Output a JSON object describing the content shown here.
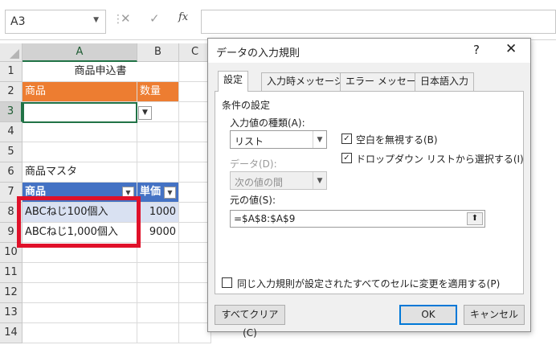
{
  "formula_bar": {
    "name_box": "A3",
    "name_dropdown_icon": "chevron-down-icon",
    "cancel_icon": "✕",
    "enter_icon": "✓",
    "fx_label": "fx",
    "formula_value": ""
  },
  "grid": {
    "columns": [
      "A",
      "B",
      "C"
    ],
    "rows": [
      "1",
      "2",
      "3",
      "4",
      "5",
      "6",
      "7",
      "8",
      "9",
      "10",
      "11",
      "12",
      "13",
      "14"
    ],
    "cells": {
      "a1": "商品申込書",
      "a2": "商品",
      "b2": "数量",
      "a3": "",
      "a6": "商品マスタ",
      "a7": "商品",
      "b7": "単価",
      "a8": "ABCねじ100個入",
      "b8": "1000",
      "a9": "ABCねじ1,000個入",
      "b9": "9000"
    },
    "colors": {
      "orange": "#ed7d31",
      "blue": "#4472c4",
      "light_blue": "#d9e1f2",
      "highlight_red": "#e0112a",
      "selection_green": "#217346"
    }
  },
  "dialog": {
    "title": "データの入力規則",
    "help": "?",
    "close": "✕",
    "tabs": [
      {
        "label": "設定",
        "active": true
      },
      {
        "label": "入力時メッセージ",
        "active": false
      },
      {
        "label": "エラー メッセージ",
        "active": false
      },
      {
        "label": "日本語入力",
        "active": false
      }
    ],
    "section_label": "条件の設定",
    "allow_label": "入力値の種類(A):",
    "allow_value": "リスト",
    "ignore_blank_label": "空白を無視する(B)",
    "ignore_blank_checked": true,
    "in_cell_dropdown_label": "ドロップダウン リストから選択する(I)",
    "in_cell_dropdown_checked": true,
    "data_label": "データ(D):",
    "data_value": "次の値の間",
    "source_label": "元の値(S):",
    "source_value": "=$A$8:$A$9",
    "apply_all_label": "同じ入力規則が設定されたすべてのセルに変更を適用する(P)",
    "apply_all_checked": false,
    "clear_all_button": "すべてクリア(C)",
    "ok_button": "OK",
    "cancel_button": "キャンセル"
  }
}
